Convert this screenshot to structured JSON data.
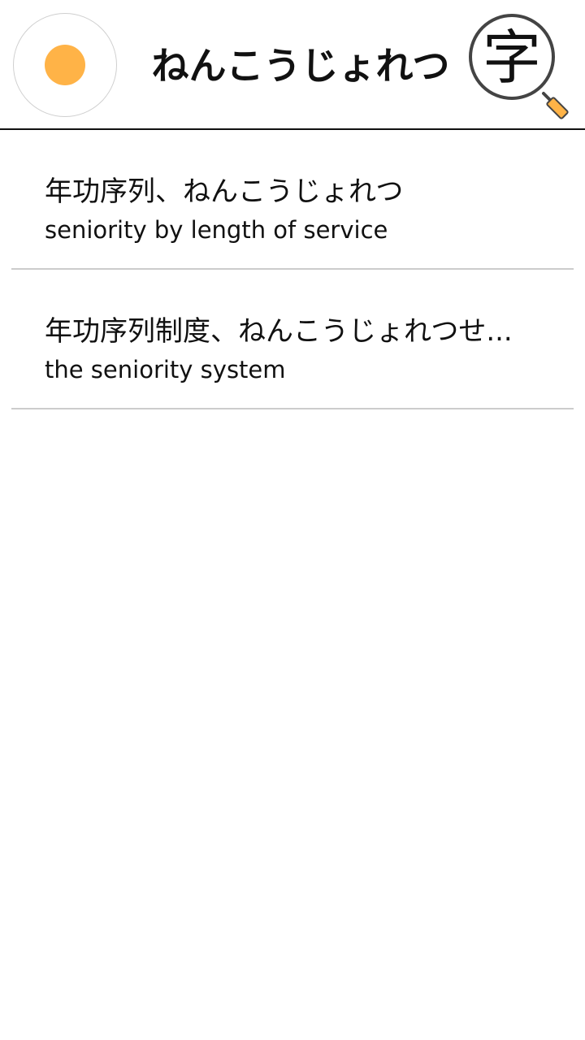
{
  "colors": {
    "accent": "#FFB347",
    "divider": "#CCCCCC",
    "header_border": "#111111",
    "magnifier_ring": "#444444"
  },
  "header": {
    "title": "ねんこうじょれつ",
    "record_icon": "record-dot-icon",
    "kanji_search": {
      "glyph": "字",
      "icon": "magnifier-icon"
    }
  },
  "results": [
    {
      "japanese": "年功序列、ねんこうじょれつ",
      "english": "seniority by length of service"
    },
    {
      "japanese": "年功序列制度、ねんこうじょれつせ...",
      "english": "the seniority system"
    }
  ]
}
